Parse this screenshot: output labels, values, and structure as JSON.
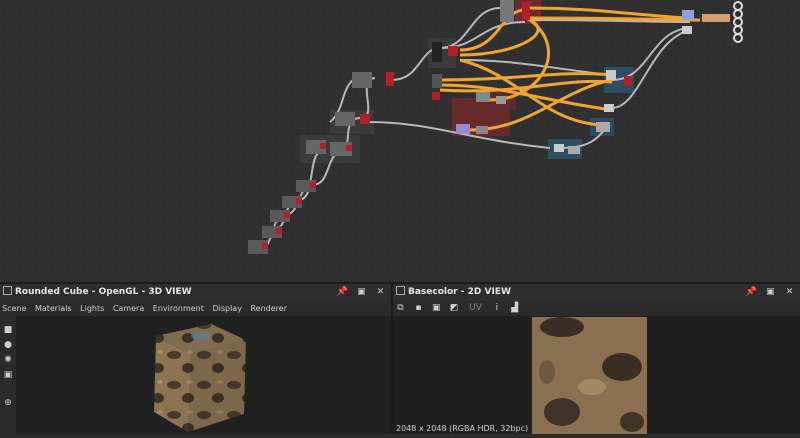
{
  "graph": {
    "colors": {
      "background": "#2f2f2f",
      "wire": "#b8b8b8",
      "wire_orange": "#f2a52e",
      "frame_red": "#7a2a2e",
      "frame_blue": "#2d5570",
      "frame_dark": "#3a3a3a"
    }
  },
  "panel3d": {
    "title": "Rounded Cube - OpenGL - 3D VIEW",
    "menu": [
      "Scene",
      "Materials",
      "Lights",
      "Camera",
      "Environment",
      "Display",
      "Renderer"
    ],
    "left_tools": [
      "camera-icon",
      "light-bulb-icon",
      "sun-icon",
      "display-icon",
      "crosshair-icon"
    ]
  },
  "panel2d": {
    "title": "Basecolor - 2D VIEW",
    "toolbar": {
      "uv_label": "UV",
      "info_label": "i"
    },
    "status": "2048 x 2048 (RGBA HDR, 32bpc)"
  },
  "window_buttons": {
    "pin": "📌",
    "max": "▣",
    "close": "✕"
  }
}
